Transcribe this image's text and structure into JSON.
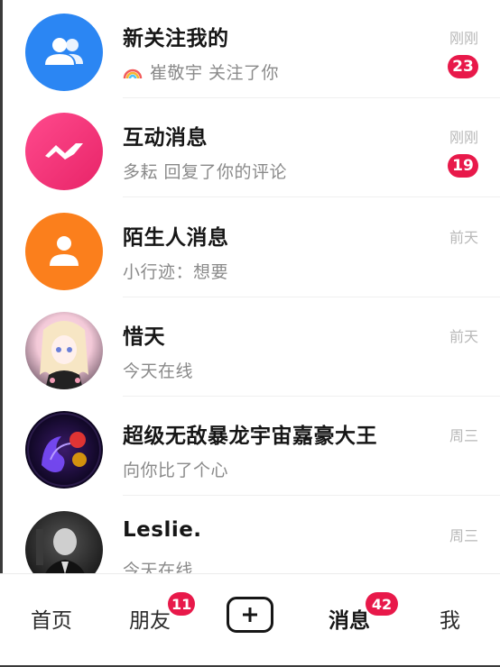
{
  "messages": [
    {
      "title": "新关注我的",
      "prefix_icon": "rainbow-icon",
      "subtitle": "崔敬宇 关注了你",
      "time": "刚刚",
      "badge": "23",
      "avatar_icon": "users-icon",
      "color": "#2b86f3"
    },
    {
      "title": "互动消息",
      "subtitle": "多耘 回复了你的评论",
      "time": "刚刚",
      "badge": "19",
      "avatar_icon": "lightning-icon",
      "color": "#f0317e"
    },
    {
      "title": "陌生人消息",
      "subtitle": "小行迹：想要",
      "time": "前天",
      "avatar_icon": "person-icon",
      "color": "#fb7f1c"
    },
    {
      "title": "惜天",
      "subtitle": "今天在线",
      "time": "前天",
      "avatar_icon": "anime-girl-avatar"
    },
    {
      "title": "超级无敌暴龙宇宙嘉豪大王",
      "subtitle": "向你比了个心",
      "time": "周三",
      "avatar_icon": "dragon-avatar"
    },
    {
      "title": "Leslie.",
      "subtitle": "今天在线",
      "time": "周三",
      "avatar_icon": "man-portrait-avatar"
    }
  ],
  "tabbar": {
    "home": "首页",
    "friends": "朋友",
    "friends_badge": "11",
    "create_icon": "plus-icon",
    "messages": "消息",
    "messages_badge": "42",
    "me": "我"
  },
  "colors": {
    "badge": "#e8194a",
    "text": "#161616",
    "subtle": "#8a8a8a"
  }
}
